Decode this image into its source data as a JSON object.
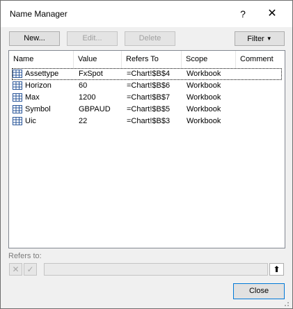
{
  "window": {
    "title": "Name Manager",
    "help_glyph": "?",
    "close_glyph": "✕"
  },
  "toolbar": {
    "new_label": "New...",
    "edit_label": "Edit...",
    "delete_label": "Delete",
    "filter_label": "Filter"
  },
  "table": {
    "columns": [
      "Name",
      "Value",
      "Refers To",
      "Scope",
      "Comment"
    ],
    "rows": [
      {
        "name": "Assettype",
        "value": "FxSpot",
        "refers_to": "=Chart!$B$4",
        "scope": "Workbook",
        "comment": ""
      },
      {
        "name": "Horizon",
        "value": "60",
        "refers_to": "=Chart!$B$6",
        "scope": "Workbook",
        "comment": ""
      },
      {
        "name": "Max",
        "value": "1200",
        "refers_to": "=Chart!$B$7",
        "scope": "Workbook",
        "comment": ""
      },
      {
        "name": "Symbol",
        "value": "GBPAUD",
        "refers_to": "=Chart!$B$5",
        "scope": "Workbook",
        "comment": ""
      },
      {
        "name": "Uic",
        "value": "22",
        "refers_to": "=Chart!$B$3",
        "scope": "Workbook",
        "comment": ""
      }
    ]
  },
  "refers_to": {
    "label": "Refers to:",
    "value": "",
    "cancel_glyph": "✕",
    "confirm_glyph": "✓",
    "collapse_glyph": "⬆"
  },
  "footer": {
    "close_label": "Close"
  },
  "icons": {
    "name_icon": "grid-icon",
    "filter_icon": "chevron-down-icon"
  },
  "colors": {
    "focus_border": "#0078d7",
    "grid_icon": "#2b579a"
  }
}
